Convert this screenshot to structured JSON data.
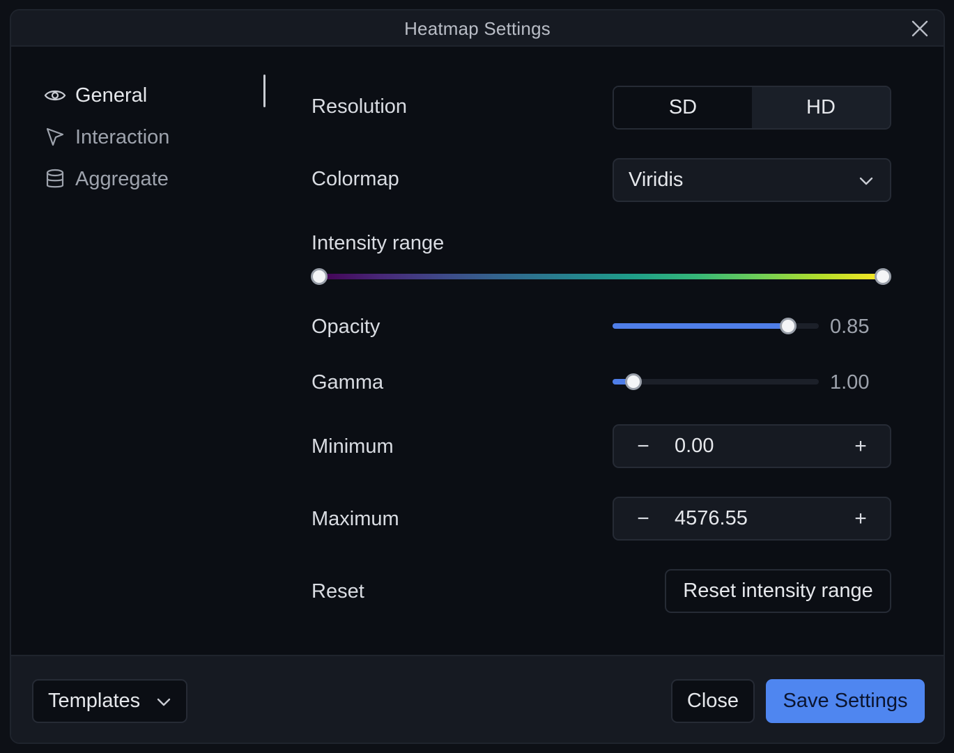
{
  "dialog": {
    "title": "Heatmap Settings"
  },
  "sidebar": {
    "items": [
      {
        "label": "General",
        "icon": "eye-icon",
        "active": true
      },
      {
        "label": "Interaction",
        "icon": "cursor-icon",
        "active": false
      },
      {
        "label": "Aggregate",
        "icon": "database-icon",
        "active": false
      }
    ]
  },
  "settings": {
    "resolution": {
      "label": "Resolution",
      "options": [
        "SD",
        "HD"
      ],
      "selected": "HD"
    },
    "colormap": {
      "label": "Colormap",
      "value": "Viridis"
    },
    "intensity_range": {
      "label": "Intensity range",
      "low_fraction": 0.0,
      "high_fraction": 1.0
    },
    "opacity": {
      "label": "Opacity",
      "value": "0.85",
      "fraction": 0.85
    },
    "gamma": {
      "label": "Gamma",
      "value": "1.00",
      "fraction": 0.1
    },
    "minimum": {
      "label": "Minimum",
      "value": "0.00",
      "decrement": "−",
      "increment": "+"
    },
    "maximum": {
      "label": "Maximum",
      "value": "4576.55",
      "decrement": "−",
      "increment": "+"
    },
    "reset": {
      "label": "Reset",
      "button": "Reset intensity range"
    }
  },
  "footer": {
    "templates_label": "Templates",
    "close_label": "Close",
    "save_label": "Save Settings"
  },
  "colors": {
    "accent": "#4f86f0",
    "background": "#0b0e14",
    "panel": "#161a22"
  }
}
